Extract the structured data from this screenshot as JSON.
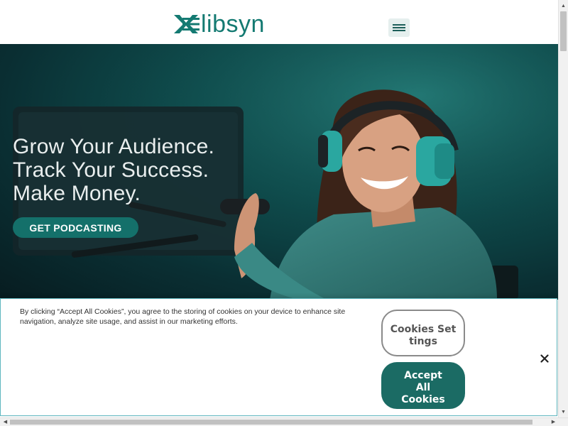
{
  "header": {
    "logo_text": "libsyn",
    "brand_color": "#147a72",
    "menu_icon": "hamburger-menu-icon"
  },
  "hero": {
    "headline": [
      "Grow Your Audience.",
      "Track Your Success.",
      "Make Money."
    ],
    "cta_label": "GET PODCASTING",
    "cta_color": "#14706a"
  },
  "cookie_banner": {
    "text": "By clicking “Accept All Cookies”, you agree to the storing of cookies on your device to enhance site navigation, analyze site usage, and assist in our marketing efforts.",
    "settings_label": "Cookies Settings",
    "accept_label": "Accept All Cookies",
    "close_icon": "close-icon",
    "accept_color": "#1b6b64"
  }
}
